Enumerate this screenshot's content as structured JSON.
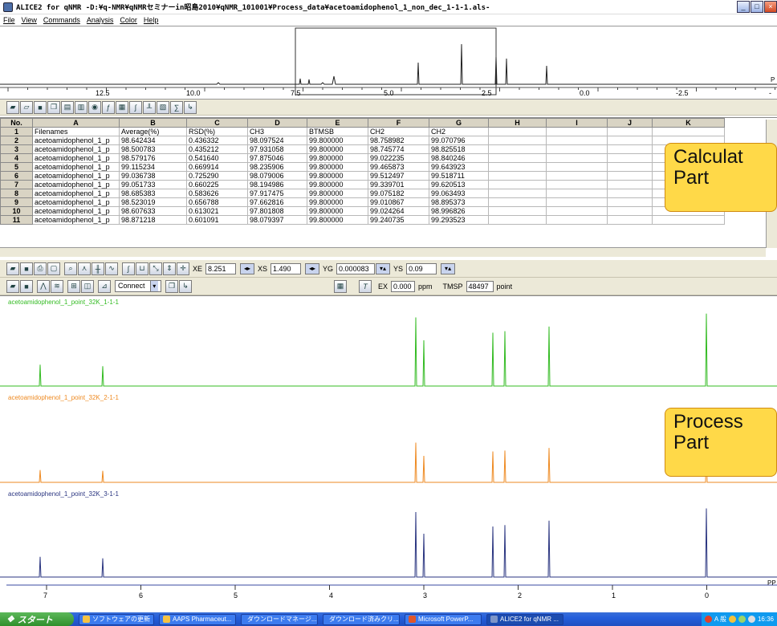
{
  "window": {
    "title": "ALICE2 for qNMR -D:¥q-NMR¥qNMRセミナーin昭島2010¥qNMR_101001¥Process_data¥acetoamidophenol_1_non_dec_1-1-1.als-",
    "controls": [
      "_",
      "□",
      "×"
    ]
  },
  "menu": [
    "File",
    "View",
    "Commands",
    "Analysis",
    "Color",
    "Help"
  ],
  "overview": {
    "axis_ticks": [
      "12.5",
      "10.0",
      "7.5",
      "5.0",
      "2.5",
      "0.0",
      "-2.5",
      "-"
    ],
    "axis_unit": "P"
  },
  "sheet": {
    "columns": [
      "No.",
      "A",
      "B",
      "C",
      "D",
      "E",
      "F",
      "G",
      "H",
      "I",
      "J",
      "K"
    ],
    "rows": [
      [
        "1",
        "Filenames",
        "Average(%)",
        "RSD(%)",
        "CH3",
        "BTMSB",
        "CH2",
        "CH2",
        "",
        "",
        "",
        ""
      ],
      [
        "2",
        "acetoamidophenol_1_p",
        "98.642434",
        "0.436332",
        "98.097524",
        "99.800000",
        "98.758982",
        "99.070796",
        "",
        "",
        "",
        ""
      ],
      [
        "3",
        "acetoamidophenol_1_p",
        "98.500783",
        "0.435212",
        "97.931058",
        "99.800000",
        "98.745774",
        "98.825518",
        "",
        "",
        "",
        ""
      ],
      [
        "4",
        "acetoamidophenol_1_p",
        "98.579176",
        "0.541640",
        "97.875046",
        "99.800000",
        "99.022235",
        "98.840246",
        "",
        "",
        "",
        ""
      ],
      [
        "5",
        "acetoamidophenol_1_p",
        "99.115234",
        "0.669914",
        "98.235906",
        "99.800000",
        "99.465873",
        "99.643923",
        "",
        "",
        "",
        ""
      ],
      [
        "6",
        "acetoamidophenol_1_p",
        "99.036738",
        "0.725290",
        "98.079006",
        "99.800000",
        "99.512497",
        "99.518711",
        "",
        "",
        "",
        ""
      ],
      [
        "7",
        "acetoamidophenol_1_p",
        "99.051733",
        "0.660225",
        "98.194986",
        "99.800000",
        "99.339701",
        "99.620513",
        "",
        "",
        "",
        ""
      ],
      [
        "8",
        "acetoamidophenol_1_p",
        "98.685383",
        "0.583626",
        "97.917475",
        "99.800000",
        "99.075182",
        "99.063493",
        "",
        "",
        "",
        ""
      ],
      [
        "9",
        "acetoamidophenol_1_p",
        "98.523019",
        "0.656788",
        "97.662816",
        "99.800000",
        "99.010867",
        "98.895373",
        "",
        "",
        "",
        ""
      ],
      [
        "10",
        "acetoamidophenol_1_p",
        "98.607633",
        "0.613021",
        "97.801808",
        "99.800000",
        "99.024264",
        "98.996826",
        "",
        "",
        "",
        ""
      ],
      [
        "11",
        "acetoamidophenol_1_p",
        "98.871218",
        "0.601091",
        "98.079397",
        "99.800000",
        "99.240735",
        "99.293523",
        "",
        "",
        "",
        ""
      ]
    ]
  },
  "toolbar2": {
    "xe_label": "XE",
    "xe_value": "8.251",
    "xs_label": "XS",
    "xs_value": "1.490",
    "yg_label": "YG",
    "yg_value": "0.000083",
    "ys_label": "YS",
    "ys_value": "0.09"
  },
  "toolbar3": {
    "mode_select": "Connect",
    "ex_label": "EX",
    "ex_value": "0.000",
    "ex_unit": "ppm",
    "tmsp_label": "TMSP",
    "tmsp_value": "48497",
    "tmsp_unit": "point"
  },
  "spectra": {
    "traces": [
      {
        "name": "acetoamidophenol_1_point_32K_1-1-1",
        "color": "#33bb22"
      },
      {
        "name": "acetoamidophenol_1_point_32K_2-1-1",
        "color": "#ee8a22"
      },
      {
        "name": "acetoamidophenol_1_point_32K_3-1-1",
        "color": "#2a3580"
      }
    ],
    "axis_ticks": [
      "7",
      "6",
      "5",
      "4",
      "3",
      "2",
      "1",
      "0"
    ],
    "axis_unit": "PP"
  },
  "callouts": {
    "calc": [
      "Calculat",
      "Part"
    ],
    "process": [
      "Process",
      "Part"
    ]
  },
  "taskbar": {
    "start": "スタート",
    "tasks": [
      "ソフトウェアの更新",
      "AAPS Pharmaceut...",
      "ダウンロードマネージ...",
      "ダウンロード済みクリ...",
      "Microsoft PowerP...",
      "ALICE2 for qNMR ..."
    ],
    "tray": [
      "A 般",
      "16:36"
    ]
  }
}
